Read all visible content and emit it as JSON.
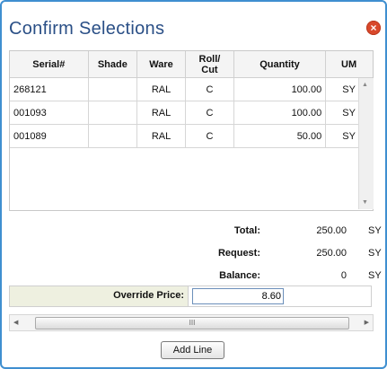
{
  "dialog": {
    "title": "Confirm Selections",
    "close_glyph": "×"
  },
  "grid": {
    "columns": [
      "Serial#",
      "Shade",
      "Ware",
      "Roll/\nCut",
      "Quantity",
      "UM"
    ],
    "rows": [
      {
        "serial": "268121",
        "shade": "",
        "ware": "RAL",
        "roll_cut": "C",
        "quantity": "100.00",
        "um": "SY"
      },
      {
        "serial": "001093",
        "shade": "",
        "ware": "RAL",
        "roll_cut": "C",
        "quantity": "100.00",
        "um": "SY"
      },
      {
        "serial": "001089",
        "shade": "",
        "ware": "RAL",
        "roll_cut": "C",
        "quantity": "50.00",
        "um": "SY"
      }
    ]
  },
  "summary": {
    "total_label": "Total:",
    "total_value": "250.00",
    "total_um": "SY",
    "request_label": "Request:",
    "request_value": "250.00",
    "request_um": "SY",
    "balance_label": "Balance:",
    "balance_value": "0",
    "balance_um": "SY"
  },
  "override": {
    "label": "Override Price:",
    "value": "8.60"
  },
  "scrollbar": {
    "thumb_grip": "III"
  },
  "actions": {
    "add_line_label": "Add Line"
  },
  "colors": {
    "title": "#2a4f86",
    "border": "#3f8fd0",
    "close": "#d9482b",
    "override_bg": "#eef0e0"
  }
}
